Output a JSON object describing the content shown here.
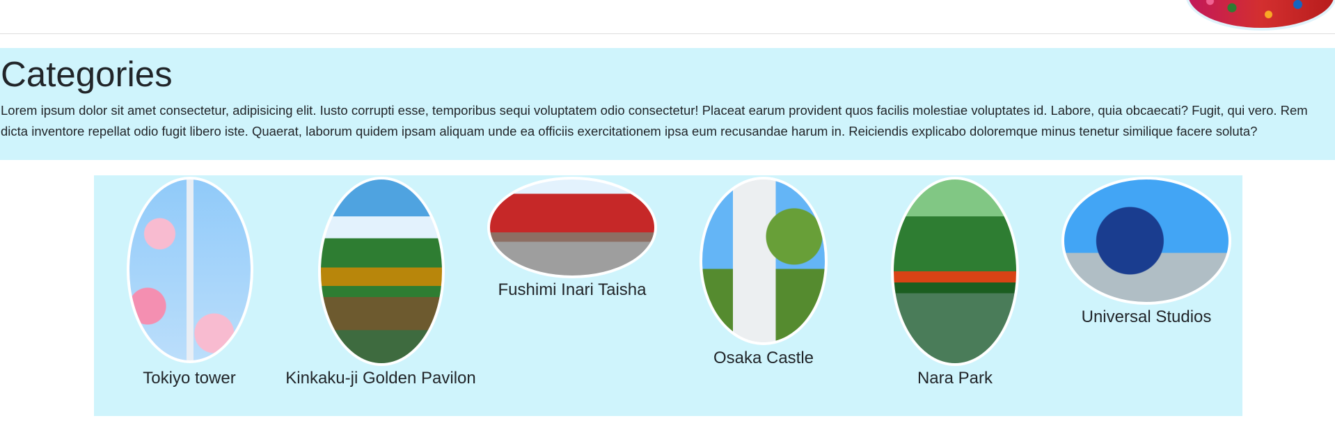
{
  "header": {
    "image_icon": "decorative-header-image"
  },
  "intro": {
    "title": "Categories",
    "body": "Lorem ipsum dolor sit amet consectetur, adipisicing elit. Iusto corrupti esse, temporibus sequi voluptatem odio consectetur! Placeat earum provident quos facilis molestiae voluptates id. Labore, quia obcaecati? Fugit, qui vero. Rem dicta inventore repellat odio fugit libero iste. Quaerat, laborum quidem ipsam aliquam unde ea officiis exercitationem ipsa eum recusandae harum in. Reiciendis explicabo doloremque minus tenetur similique facere soluta?"
  },
  "categories": [
    {
      "label": "Tokiyo tower",
      "icon": "tokyo-tower-photo"
    },
    {
      "label": "Kinkaku-ji Golden Pavilon",
      "icon": "kinkaku-ji-photo"
    },
    {
      "label": "Fushimi Inari Taisha",
      "icon": "fushimi-inari-photo"
    },
    {
      "label": "Osaka Castle",
      "icon": "osaka-castle-photo"
    },
    {
      "label": "Nara Park",
      "icon": "nara-park-photo"
    },
    {
      "label": "Universal Studios",
      "icon": "universal-studios-photo"
    }
  ],
  "colors": {
    "panel_bg": "#cff4fc",
    "text": "#212529"
  }
}
